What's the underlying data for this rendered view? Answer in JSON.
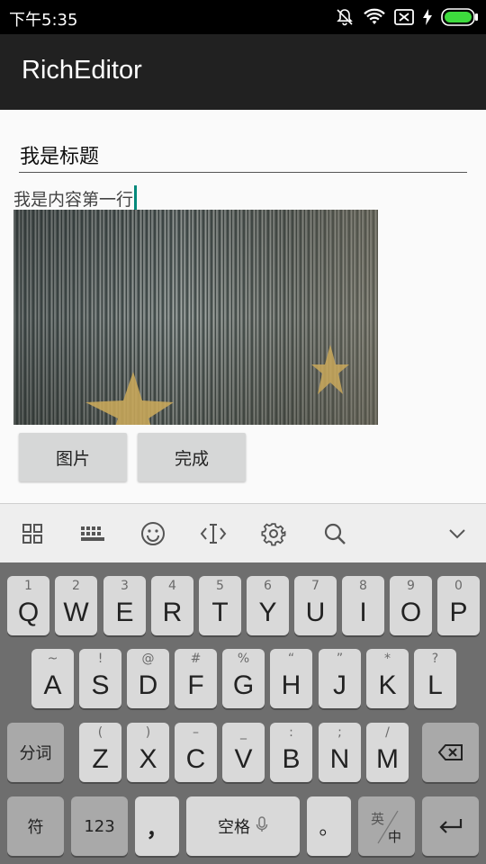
{
  "status_bar": {
    "time": "下午5:35",
    "icons": [
      "notifications-off-icon",
      "wifi-icon",
      "no-sim-icon",
      "charging-icon",
      "battery-icon"
    ],
    "battery_color": "#3ddc3d"
  },
  "app_bar": {
    "title": "RichEditor",
    "background": "#212121"
  },
  "editor": {
    "title_value": "我是标题",
    "content_line": "我是内容第一行",
    "cursor_color": "#00897b",
    "image_name": "striped-fabric-with-stars-image"
  },
  "buttons": {
    "image_label": "图片",
    "done_label": "完成"
  },
  "keyboard_toolbar": {
    "icons": [
      "grid-icon",
      "keyboard-icon",
      "emoji-icon",
      "cursor-move-icon",
      "settings-icon",
      "search-icon",
      "chevron-down-icon"
    ]
  },
  "keyboard": {
    "row1": [
      {
        "hint": "1",
        "key": "Q"
      },
      {
        "hint": "2",
        "key": "W"
      },
      {
        "hint": "3",
        "key": "E"
      },
      {
        "hint": "4",
        "key": "R"
      },
      {
        "hint": "5",
        "key": "T"
      },
      {
        "hint": "6",
        "key": "Y"
      },
      {
        "hint": "7",
        "key": "U"
      },
      {
        "hint": "8",
        "key": "I"
      },
      {
        "hint": "9",
        "key": "O"
      },
      {
        "hint": "0",
        "key": "P"
      }
    ],
    "row2": [
      {
        "hint": "~",
        "key": "A"
      },
      {
        "hint": "!",
        "key": "S"
      },
      {
        "hint": "@",
        "key": "D"
      },
      {
        "hint": "#",
        "key": "F"
      },
      {
        "hint": "%",
        "key": "G"
      },
      {
        "hint": "“",
        "key": "H"
      },
      {
        "hint": "”",
        "key": "J"
      },
      {
        "hint": "*",
        "key": "K"
      },
      {
        "hint": "?",
        "key": "L"
      }
    ],
    "row3": [
      {
        "hint": "(",
        "key": "Z"
      },
      {
        "hint": ")",
        "key": "X"
      },
      {
        "hint": "–",
        "key": "C"
      },
      {
        "hint": "_",
        "key": "V"
      },
      {
        "hint": ":",
        "key": "B"
      },
      {
        "hint": ";",
        "key": "N"
      },
      {
        "hint": "/",
        "key": "M"
      }
    ],
    "segment_label": "分词",
    "symbol_label": "符",
    "numbers_label": "123",
    "comma_label": "，",
    "space_label": "空格",
    "period_label": "。",
    "lang_top": "英",
    "lang_bottom": "中"
  }
}
